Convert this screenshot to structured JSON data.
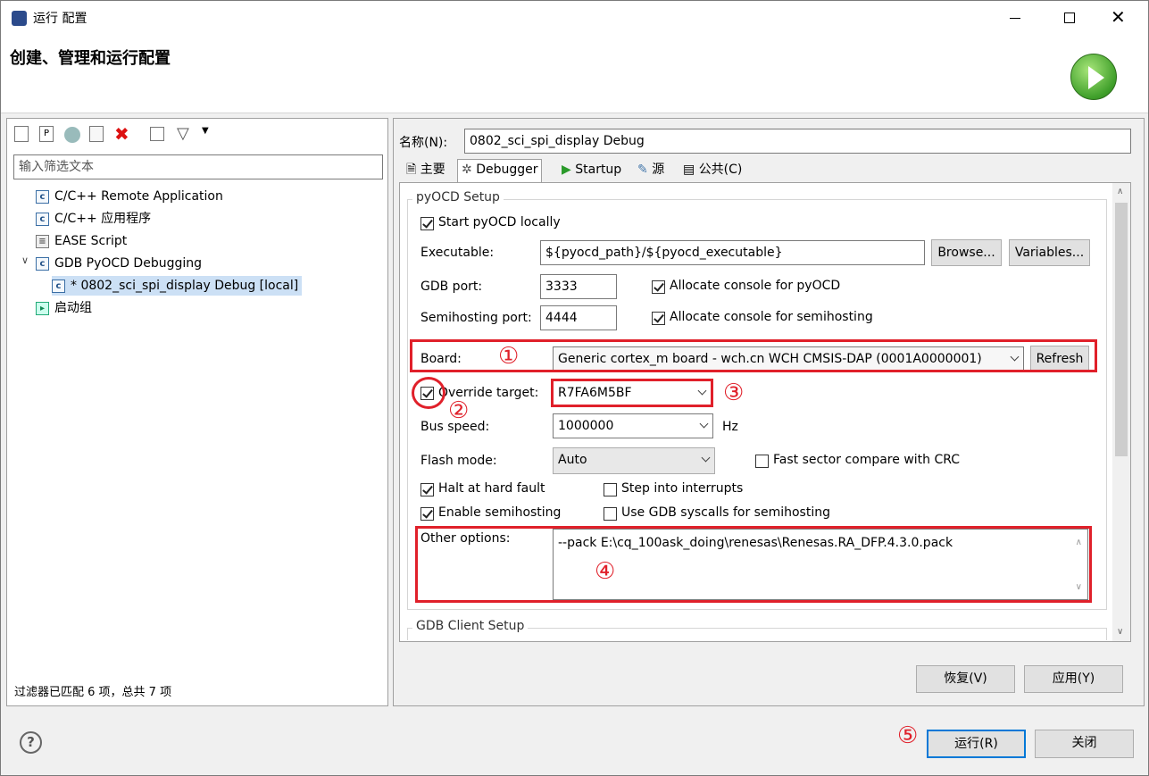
{
  "window": {
    "title": "运行 配置",
    "heading": "创建、管理和运行配置"
  },
  "left": {
    "filter_placeholder": "输入筛选文本",
    "tree": [
      {
        "icon": "c-file-icon",
        "label": "C/C++ Remote Application"
      },
      {
        "icon": "c-file-icon",
        "label": "C/C++ 应用程序"
      },
      {
        "icon": "script-icon",
        "label": "EASE Script"
      },
      {
        "icon": "c-file-icon",
        "label": "GDB PyOCD Debugging"
      },
      {
        "icon": "c-file-icon",
        "label": "* 0802_sci_spi_display Debug [local]"
      },
      {
        "icon": "launch-group-icon",
        "label": "启动组"
      }
    ],
    "status": "过滤器已匹配 6 项，总共 7 项"
  },
  "right": {
    "name_label": "名称(N):",
    "name_value": "0802_sci_spi_display Debug",
    "tabs": [
      "主要",
      "Debugger",
      "Startup",
      "源",
      "公共(C)"
    ],
    "pyocd": {
      "group_title": "pyOCD Setup",
      "start_locally": "Start pyOCD locally",
      "executable_label": "Executable:",
      "executable_value": "${pyocd_path}/${pyocd_executable}",
      "browse": "Browse...",
      "variables": "Variables...",
      "gdb_port_label": "GDB port:",
      "gdb_port_value": "3333",
      "alloc_console": "Allocate console for pyOCD",
      "semi_port_label": "Semihosting port:",
      "semi_port_value": "4444",
      "alloc_semi": "Allocate console for semihosting",
      "board_label": "Board:",
      "board_value": "Generic cortex_m board - wch.cn WCH CMSIS-DAP (0001A0000001)",
      "refresh": "Refresh",
      "override_label": "Override target:",
      "override_value": "R7FA6M5BF",
      "bus_label": "Bus speed:",
      "bus_value": "1000000",
      "hz": "Hz",
      "flash_label": "Flash mode:",
      "flash_value": "Auto",
      "fast_sector": "Fast sector compare with CRC",
      "halt": "Halt at hard fault",
      "step": "Step into interrupts",
      "enable_semi": "Enable semihosting",
      "use_gdb": "Use GDB syscalls for semihosting",
      "other_label": "Other options:",
      "other_value": "--pack E:\\cq_100ask_doing\\renesas\\Renesas.RA_DFP.4.3.0.pack"
    },
    "gdb_client_title": "GDB Client Setup",
    "revert": "恢复(V)",
    "apply": "应用(Y)"
  },
  "footer": {
    "run": "运行(R)",
    "close": "关闭"
  },
  "annotations": [
    "①",
    "②",
    "③",
    "④",
    "⑤"
  ]
}
